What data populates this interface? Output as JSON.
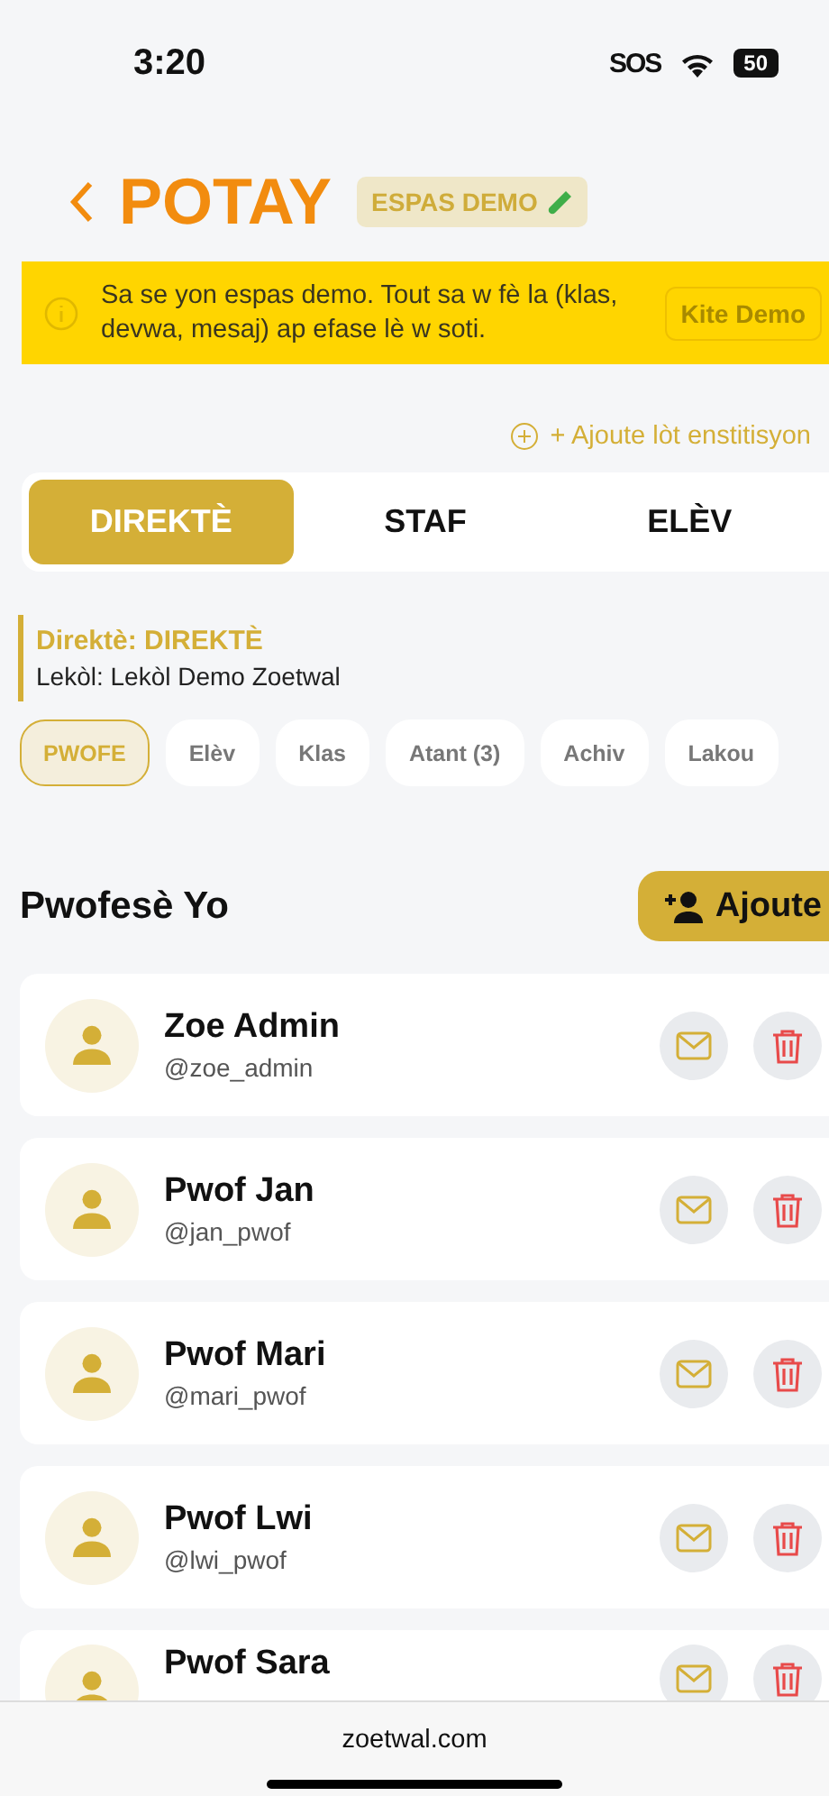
{
  "status_bar": {
    "time": "3:20",
    "sos": "SOS",
    "battery": "50"
  },
  "header": {
    "title": "POTAY",
    "badge": "ESPAS DEMO"
  },
  "banner": {
    "message": "Sa se yon espas demo. Tout sa w fè la (klas, devwa, mesaj) ap efase lè w soti.",
    "button": "Kite Demo"
  },
  "add_institution": "+ Ajoute lòt enstitisyon",
  "tabs": [
    {
      "label": "DIREKTÈ",
      "selected": true
    },
    {
      "label": "STAF",
      "selected": false
    },
    {
      "label": "ELÈV",
      "selected": false
    }
  ],
  "director": {
    "title": "Direktè: DIREKTÈ",
    "school": "Lekòl: Lekòl Demo Zoetwal"
  },
  "chips": [
    {
      "label": "PWOFE",
      "selected": true
    },
    {
      "label": "Elèv",
      "selected": false
    },
    {
      "label": "Klas",
      "selected": false
    },
    {
      "label": "Atant (3)",
      "selected": false
    },
    {
      "label": "Achiv",
      "selected": false
    },
    {
      "label": "Lakou",
      "selected": false
    }
  ],
  "section": {
    "title": "Pwofesè Yo",
    "add_button": "Ajoute"
  },
  "teachers": [
    {
      "name": "Zoe Admin",
      "username": "@zoe_admin"
    },
    {
      "name": "Pwof Jan",
      "username": "@jan_pwof"
    },
    {
      "name": "Pwof Mari",
      "username": "@mari_pwof"
    },
    {
      "name": "Pwof Lwi",
      "username": "@lwi_pwof"
    },
    {
      "name": "Pwof Sara"
    }
  ],
  "browser_bar": {
    "url": "zoetwal.com"
  }
}
